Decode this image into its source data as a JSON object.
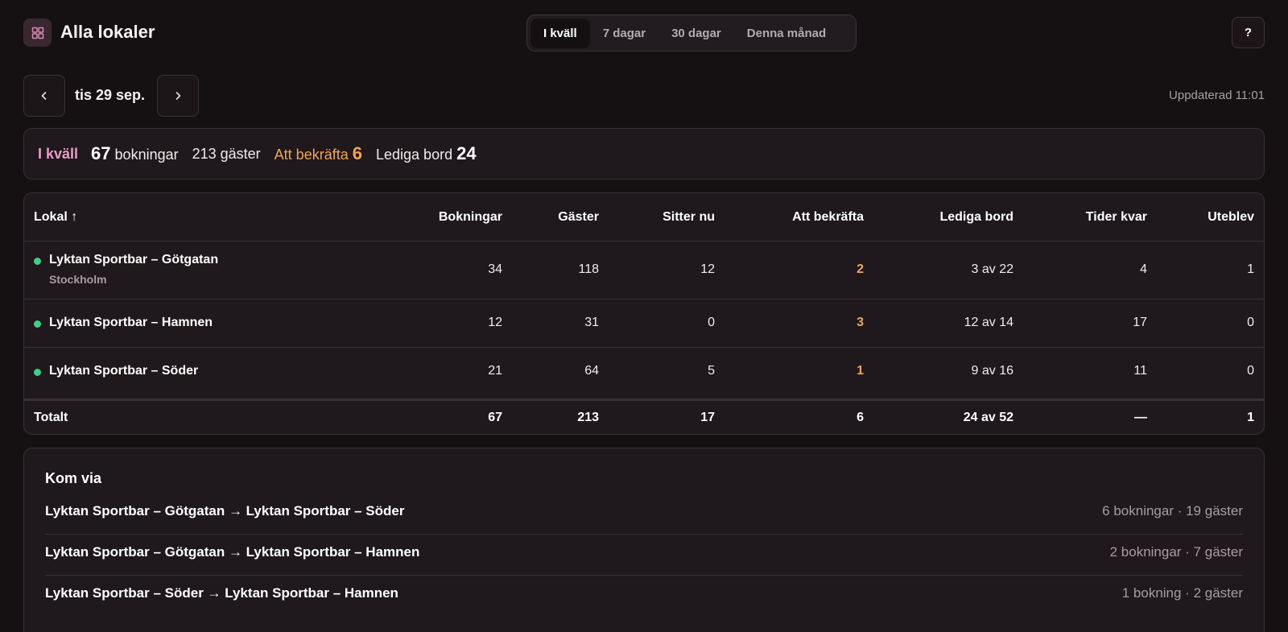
{
  "header": {
    "title": "Alla lokaler",
    "icon": "grid-icon",
    "tabs": [
      {
        "label": "I kväll",
        "active": true
      },
      {
        "label": "7 dagar",
        "active": false
      },
      {
        "label": "30 dagar",
        "active": false
      },
      {
        "label": "Denna månad",
        "active": false
      }
    ],
    "help_label": "?"
  },
  "date_nav": {
    "date": "tis 29 sep.",
    "updated": "Uppdaterad 11:01"
  },
  "summary": {
    "period": "I kväll",
    "bookings_count": "67",
    "bookings_label": "bokningar",
    "guests": "213 gäster",
    "confirm_label": "Att bekräfta",
    "confirm_count": "6",
    "free_tables_label": "Lediga bord",
    "free_tables_count": "24"
  },
  "table": {
    "columns": [
      "Lokal ↑",
      "Bokningar",
      "Gäster",
      "Sitter nu",
      "Att bekräfta",
      "Lediga bord",
      "Tider kvar",
      "Uteblev"
    ],
    "rows": [
      {
        "name": "Lyktan Sportbar – Götgatan",
        "city": "Stockholm",
        "bookings": "34",
        "guests": "118",
        "seated": "12",
        "to_confirm": "2",
        "free_tables": "3 av 22",
        "times_left": "4",
        "no_show": "1"
      },
      {
        "name": "Lyktan Sportbar – Hamnen",
        "city": "",
        "bookings": "12",
        "guests": "31",
        "seated": "0",
        "to_confirm": "3",
        "free_tables": "12 av 14",
        "times_left": "17",
        "no_show": "0"
      },
      {
        "name": "Lyktan Sportbar – Söder",
        "city": "",
        "bookings": "21",
        "guests": "64",
        "seated": "5",
        "to_confirm": "1",
        "free_tables": "9 av 16",
        "times_left": "11",
        "no_show": "0"
      }
    ],
    "total": {
      "label": "Totalt",
      "bookings": "67",
      "guests": "213",
      "seated": "17",
      "to_confirm": "6",
      "free_tables": "24 av 52",
      "times_left": "—",
      "no_show": "1"
    }
  },
  "via": {
    "title": "Kom via",
    "items": [
      {
        "route": "Lyktan Sportbar – Götgatan → Lyktan Sportbar – Söder",
        "stats": "6 bokningar · 19 gäster"
      },
      {
        "route": "Lyktan Sportbar – Götgatan → Lyktan Sportbar – Hamnen",
        "stats": "2 bokningar · 7 gäster"
      },
      {
        "route": "Lyktan Sportbar – Söder → Lyktan Sportbar – Hamnen",
        "stats": "1 bokning · 2 gäster"
      }
    ]
  },
  "colors": {
    "background": "#151113",
    "card": "#1f181c",
    "accent_pink": "#ec9cc8",
    "accent_orange": "#f0a657",
    "status_green": "#3ecf85"
  }
}
